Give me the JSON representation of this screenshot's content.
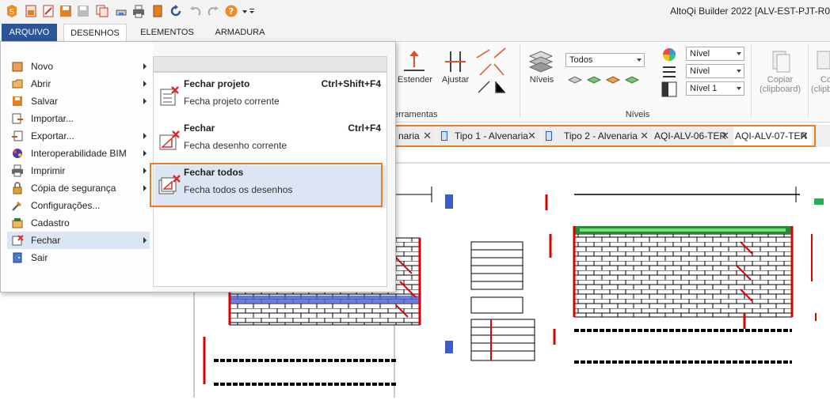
{
  "window": {
    "title": "AltoQi Builder 2022 [ALV-EST-PJT-R0"
  },
  "quick_access": [
    "app-logo-icon",
    "new-file-icon",
    "open-file-icon",
    "save-icon",
    "save-as-icon",
    "copy-icon",
    "print-preview-icon",
    "print-icon",
    "book-icon",
    "refresh-icon",
    "undo-icon",
    "redo-icon",
    "help-icon",
    "customize-icon"
  ],
  "ribbon_tabs": [
    "ARQUIVO",
    "DESENHOS",
    "ELEMENTOS",
    "ARMADURA"
  ],
  "ribbon": {
    "estender": "Estender",
    "ajustar": "Ajustar",
    "ferramentas_group": "erramentas",
    "niveis_button": "Níveis",
    "todos_combo": "Todos",
    "nivel_combo_1": "Nível",
    "nivel_combo_2": "Nível",
    "nivel_combo_3": "Nível 1",
    "niveis_group": "Níveis",
    "copiar_line1": "Copiar",
    "copiar_line2": "(clipboard)",
    "co_line1": "Co",
    "co_line2": "(clipb"
  },
  "document_tabs": [
    {
      "label": "naria",
      "close": "✕"
    },
    {
      "label": "Tipo 1 - Alvenaria",
      "close": "✕"
    },
    {
      "label": "Tipo 2 - Alvenaria",
      "close": "✕"
    },
    {
      "label": "AQI-ALV-06-TER",
      "close": "✕"
    },
    {
      "label": "AQI-ALV-07-TER",
      "close": "✕"
    }
  ],
  "file_menu": {
    "items": [
      {
        "label": "Novo",
        "icon": "new-icon",
        "submenu": true
      },
      {
        "label": "Abrir",
        "icon": "open-icon",
        "submenu": true
      },
      {
        "label": "Salvar",
        "icon": "save-icon",
        "submenu": true
      },
      {
        "label": "Importar...",
        "icon": "import-icon",
        "submenu": false
      },
      {
        "label": "Exportar...",
        "icon": "export-icon",
        "submenu": true
      },
      {
        "label": "Interoperabilidade BIM",
        "icon": "bim-icon",
        "submenu": true
      },
      {
        "label": "Imprimir",
        "icon": "print-icon",
        "submenu": true
      },
      {
        "label": "Cópia de segurança",
        "icon": "backup-icon",
        "submenu": true
      },
      {
        "label": "Configurações...",
        "icon": "settings-icon",
        "submenu": false
      },
      {
        "label": "Cadastro",
        "icon": "register-icon",
        "submenu": false
      },
      {
        "label": "Fechar",
        "icon": "close-doc-icon",
        "submenu": true
      },
      {
        "label": "Sair",
        "icon": "exit-icon",
        "submenu": false
      }
    ],
    "submenu": [
      {
        "title": "Fechar projeto",
        "shortcut": "Ctrl+Shift+F4",
        "desc": "Fecha projeto corrente"
      },
      {
        "title": "Fechar",
        "shortcut": "Ctrl+F4",
        "desc": "Fecha desenho corrente"
      },
      {
        "title": "Fechar todos",
        "shortcut": "",
        "desc": "Fecha todos os desenhos"
      }
    ]
  },
  "colors": {
    "accent": "#2b579a",
    "highlight": "#ef7d1b",
    "selection": "#dbe5f3"
  }
}
